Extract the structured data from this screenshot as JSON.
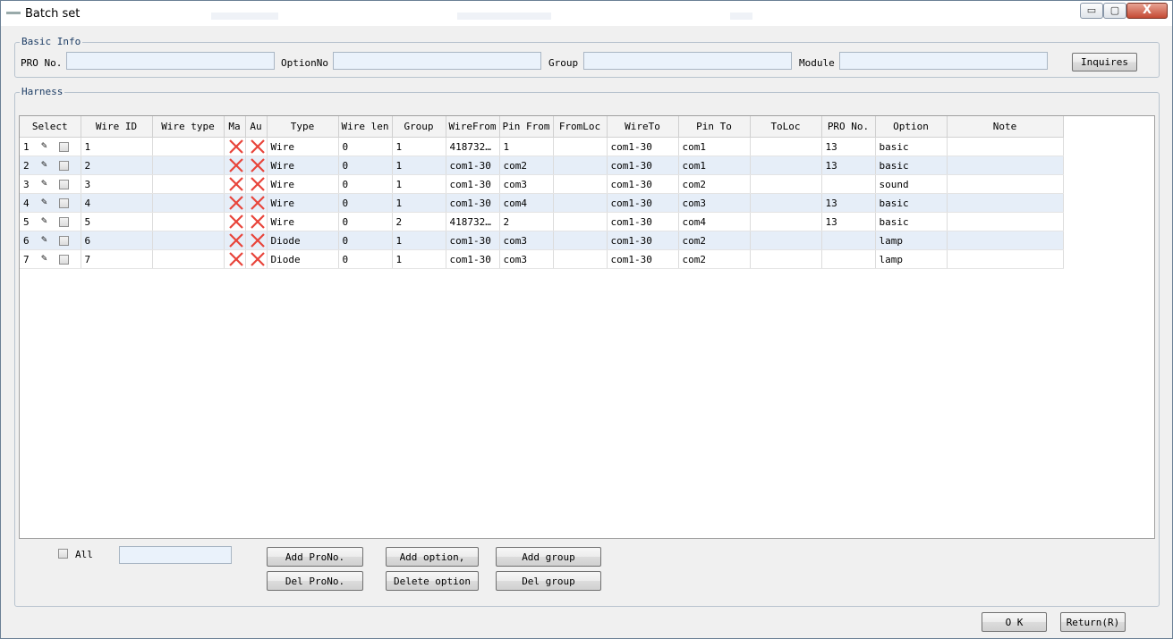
{
  "window": {
    "title": "Batch set",
    "buttons": {
      "minimize": "▭",
      "maximize": "▢",
      "close": "X"
    }
  },
  "basic_info": {
    "legend": "Basic Info",
    "pro_no_label": "PRO No.",
    "option_no_label": "OptionNo",
    "group_label": "Group",
    "module_label": "Module",
    "pro_no_value": "",
    "option_no_value": "",
    "group_value": "",
    "module_value": "",
    "inquires_label": "Inquires"
  },
  "harness": {
    "legend": "Harness",
    "columns": [
      "Select",
      "Wire ID",
      "Wire type",
      "Ma",
      "Au",
      "Type",
      "Wire len",
      "Group",
      "WireFrom",
      "Pin From",
      "FromLoc",
      "WireTo",
      "Pin To",
      "ToLoc",
      "PRO No.",
      "Option",
      "Note"
    ],
    "rows": [
      {
        "num": "1",
        "wire_id": "1",
        "wire_type": "",
        "type": "Wire",
        "wire_len": "0",
        "group": "1",
        "wire_from": "418732…",
        "pin_from": "1",
        "from_loc": "",
        "wire_to": "com1-30",
        "pin_to": "com1",
        "to_loc": "",
        "pro_no": "13",
        "option": "basic",
        "note": ""
      },
      {
        "num": "2",
        "wire_id": "2",
        "wire_type": "",
        "type": "Wire",
        "wire_len": "0",
        "group": "1",
        "wire_from": "com1-30",
        "pin_from": "com2",
        "from_loc": "",
        "wire_to": "com1-30",
        "pin_to": "com1",
        "to_loc": "",
        "pro_no": "13",
        "option": "basic",
        "note": ""
      },
      {
        "num": "3",
        "wire_id": "3",
        "wire_type": "",
        "type": "Wire",
        "wire_len": "0",
        "group": "1",
        "wire_from": "com1-30",
        "pin_from": "com3",
        "from_loc": "",
        "wire_to": "com1-30",
        "pin_to": "com2",
        "to_loc": "",
        "pro_no": "",
        "option": "sound",
        "note": ""
      },
      {
        "num": "4",
        "wire_id": "4",
        "wire_type": "",
        "type": "Wire",
        "wire_len": "0",
        "group": "1",
        "wire_from": "com1-30",
        "pin_from": "com4",
        "from_loc": "",
        "wire_to": "com1-30",
        "pin_to": "com3",
        "to_loc": "",
        "pro_no": "13",
        "option": "basic",
        "note": ""
      },
      {
        "num": "5",
        "wire_id": "5",
        "wire_type": "",
        "type": "Wire",
        "wire_len": "0",
        "group": "2",
        "wire_from": "418732…",
        "pin_from": "2",
        "from_loc": "",
        "wire_to": "com1-30",
        "pin_to": "com4",
        "to_loc": "",
        "pro_no": "13",
        "option": "basic",
        "note": ""
      },
      {
        "num": "6",
        "wire_id": "6",
        "wire_type": "",
        "type": "Diode",
        "wire_len": "0",
        "group": "1",
        "wire_from": "com1-30",
        "pin_from": "com3",
        "from_loc": "",
        "wire_to": "com1-30",
        "pin_to": "com2",
        "to_loc": "",
        "pro_no": "",
        "option": "lamp",
        "note": ""
      },
      {
        "num": "7",
        "wire_id": "7",
        "wire_type": "",
        "type": "Diode",
        "wire_len": "0",
        "group": "1",
        "wire_from": "com1-30",
        "pin_from": "com3",
        "from_loc": "",
        "wire_to": "com1-30",
        "pin_to": "com2",
        "to_loc": "",
        "pro_no": "",
        "option": "lamp",
        "note": ""
      }
    ]
  },
  "bottom": {
    "all_label": "All",
    "all_value": "",
    "add_pro_no": "Add ProNo.",
    "del_pro_no": "Del ProNo.",
    "add_option": "Add option,",
    "delete_option": "Delete option",
    "add_group": "Add group",
    "del_group": "Del group",
    "ok": "O K",
    "return": "Return(R)"
  },
  "colors": {
    "error_x": "#e8443a",
    "alt_row": "#e6eef8",
    "field_bg": "#eaf2fb"
  }
}
